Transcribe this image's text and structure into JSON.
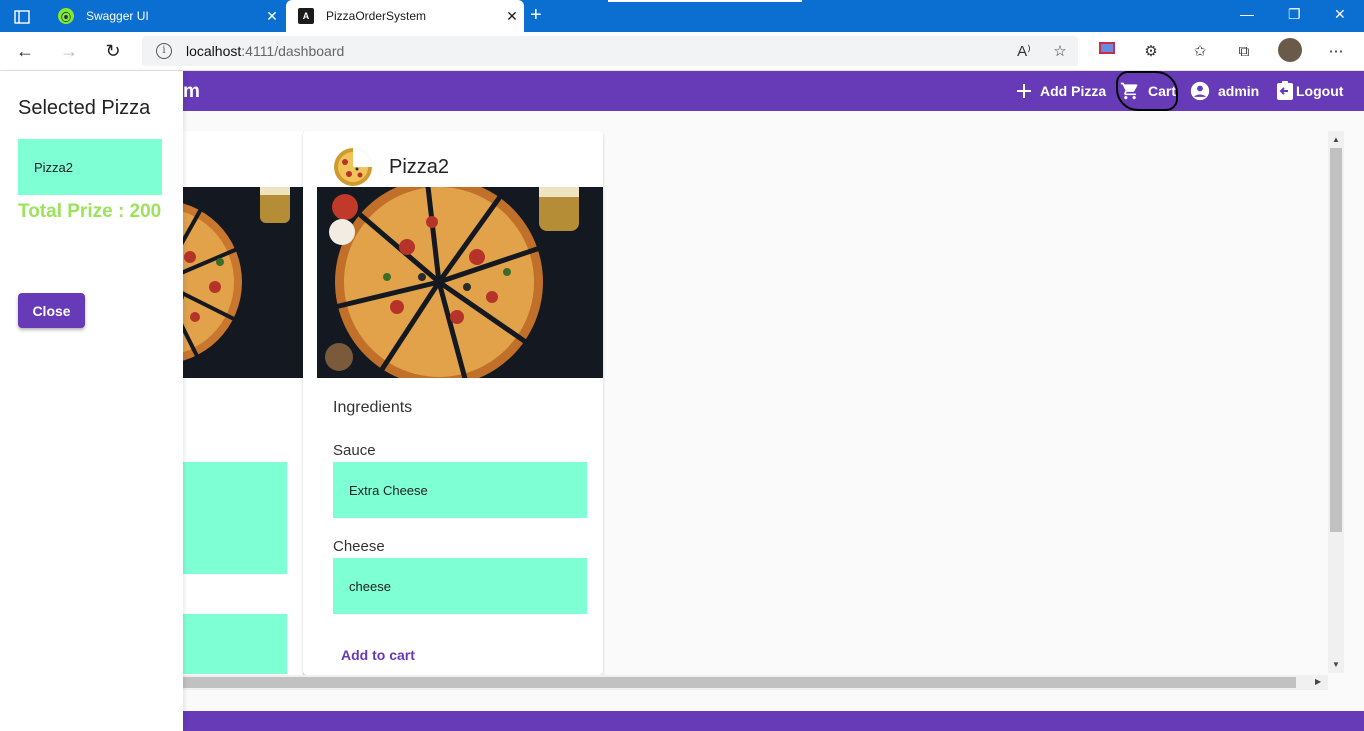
{
  "browser": {
    "tabs": [
      {
        "title": "Swagger UI",
        "active": false
      },
      {
        "title": "PizzaOrderSystem",
        "active": true
      }
    ],
    "url_host": "localhost",
    "url_rest": ":4111/dashboard",
    "icons": [
      "tabs-icon",
      "back-icon",
      "forward-icon",
      "refresh-icon",
      "info-icon",
      "read-aloud-icon",
      "favorite-add-icon",
      "extension-icon",
      "puzzle-icon",
      "favorites-icon",
      "collections-icon",
      "profile-avatar",
      "more-icon"
    ]
  },
  "toolbar": {
    "brand_fragment": "m",
    "add_pizza": "Add Pizza",
    "cart": "Cart",
    "user": "admin",
    "logout": "Logout",
    "color": "#673ab7"
  },
  "cards": {
    "pizza2": {
      "title": "Pizza2",
      "ingredients_label": "Ingredients",
      "sauce_label": "Sauce",
      "sauce_value": "Extra Cheese",
      "cheese_label": "Cheese",
      "cheese_value": "cheese",
      "add_to_cart": "Add to cart"
    }
  },
  "sidenav": {
    "title": "Selected Pizza",
    "items": [
      {
        "name": "Pizza2"
      }
    ],
    "total": "Total Prize : 200",
    "close": "Close"
  },
  "colors": {
    "primary": "#673ab7",
    "field": "#7fffd4",
    "total": "#9be35b",
    "browser": "#0a6fd1"
  }
}
